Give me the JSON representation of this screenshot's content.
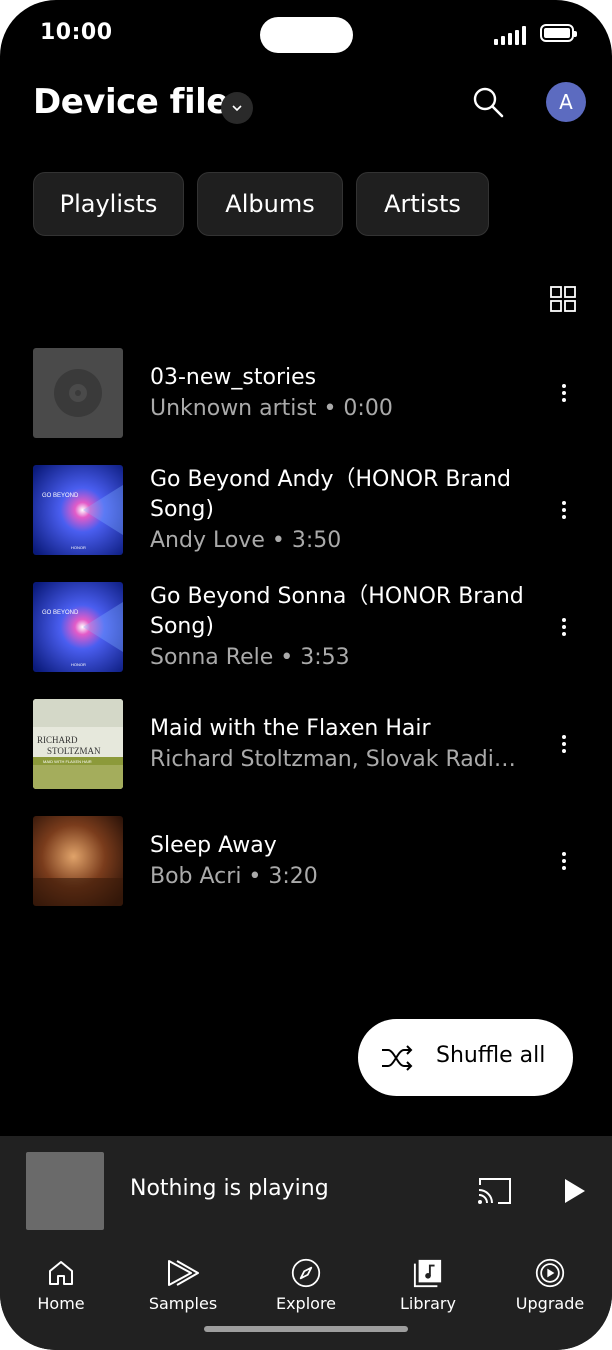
{
  "status_bar": {
    "time": "10:00"
  },
  "header": {
    "title": "Device files",
    "avatar_letter": "A"
  },
  "chips": [
    "Playlists",
    "Albums",
    "Artists"
  ],
  "tracks": [
    {
      "title": "03-new_stories",
      "subtitle": "Unknown artist • 0:00",
      "art": "vinyl-placeholder"
    },
    {
      "title": "Go Beyond Andy（HONOR Brand Song)",
      "subtitle": "Andy Love • 3:50",
      "art": "go-beyond-cover"
    },
    {
      "title": "Go Beyond Sonna（HONOR Brand Song)",
      "subtitle": "Sonna Rele • 3:53",
      "art": "go-beyond-cover"
    },
    {
      "title": "Maid with the Flaxen Hair",
      "subtitle": "Richard Stoltzman, Slovak Radio …",
      "art": "richard-stoltzman-cover"
    },
    {
      "title": "Sleep Away",
      "subtitle": "Bob Acri • 3:20",
      "art": "piano-cover"
    }
  ],
  "cover_text": {
    "go_beyond": "GO BEYOND",
    "honor": "HONOR",
    "richard": "RICHARD",
    "stoltzman": "STOLTZMAN",
    "maid": "MAID WITH FLAXEN HAIR"
  },
  "shuffle": {
    "label": "Shuffle all"
  },
  "mini_player": {
    "text": "Nothing is playing"
  },
  "nav": [
    {
      "label": "Home",
      "icon": "home-icon"
    },
    {
      "label": "Samples",
      "icon": "samples-icon"
    },
    {
      "label": "Explore",
      "icon": "compass-icon"
    },
    {
      "label": "Library",
      "icon": "library-icon"
    },
    {
      "label": "Upgrade",
      "icon": "upgrade-icon"
    }
  ],
  "colors": {
    "background": "#000000",
    "surface": "#212121",
    "avatar": "#5c6bc0",
    "secondary_text": "#aaaaaa"
  }
}
